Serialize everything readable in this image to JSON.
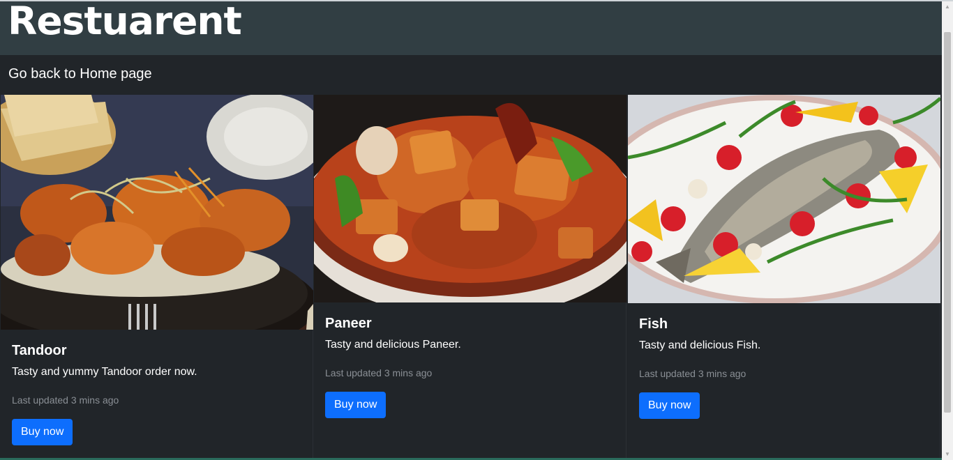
{
  "header": {
    "site_title": "Restuarent"
  },
  "nav": {
    "back_link": "Go back to Home page"
  },
  "cards": [
    {
      "title": "Tandoor",
      "text": "Tasty and yummy Tandoor order now.",
      "meta": "Last updated 3 mins ago",
      "button": "Buy now",
      "image": "tandoor-chicken-photo"
    },
    {
      "title": "Paneer",
      "text": "Tasty and delicious Paneer.",
      "meta": "Last updated 3 mins ago",
      "button": "Buy now",
      "image": "paneer-curry-photo"
    },
    {
      "title": "Fish",
      "text": "Tasty and delicious Fish.",
      "meta": "Last updated 3 mins ago",
      "button": "Buy now",
      "image": "grilled-fish-photo"
    }
  ],
  "colors": {
    "header_bg": "#313e43",
    "page_bg": "#212529",
    "button_primary": "#0d6efd",
    "muted_text": "#8a8f95"
  }
}
